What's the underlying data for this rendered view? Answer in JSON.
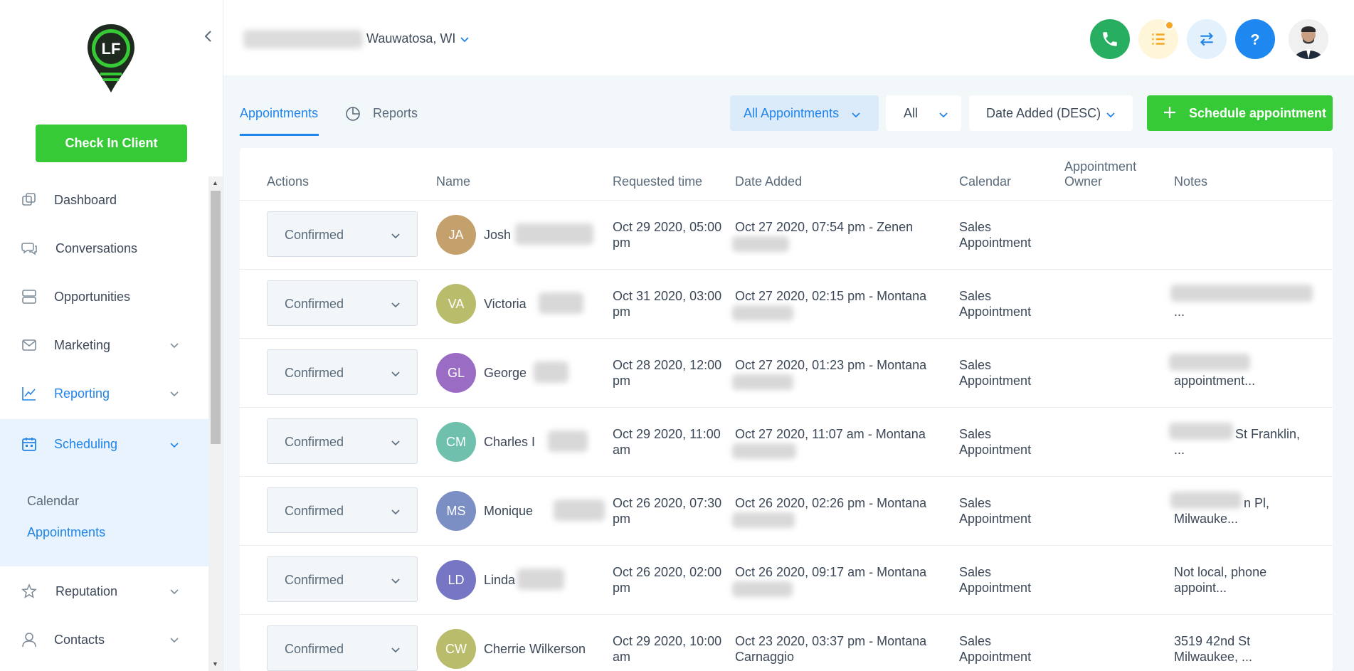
{
  "sidebar": {
    "logo_text": "LF",
    "checkin_label": "Check In Client",
    "items": [
      {
        "label": "Dashboard"
      },
      {
        "label": "Conversations"
      },
      {
        "label": "Opportunities"
      },
      {
        "label": "Marketing"
      },
      {
        "label": "Reporting"
      },
      {
        "label": "Scheduling"
      },
      {
        "label": "Reputation"
      },
      {
        "label": "Contacts"
      }
    ],
    "subitems": [
      {
        "label": "Calendar"
      },
      {
        "label": "Appointments"
      }
    ]
  },
  "header": {
    "location": "Wauwatosa, WI"
  },
  "tabs": [
    {
      "label": "Appointments"
    },
    {
      "label": "Reports"
    }
  ],
  "filters": {
    "type": "All Appointments",
    "status": "All",
    "sort": "Date Added (DESC)",
    "schedule_button": "Schedule appointment"
  },
  "table": {
    "headers": {
      "actions": "Actions",
      "name": "Name",
      "requested": "Requested time",
      "added": "Date Added",
      "calendar": "Calendar",
      "owner_1": "Appointment",
      "owner_2": "Owner",
      "notes": "Notes"
    },
    "rows": [
      {
        "status": "Confirmed",
        "initials": "JA",
        "color": "#c4a06d",
        "name": "Josh",
        "req1": "Oct 29 2020, 05:00",
        "req2": "pm",
        "add1": "Oct 27 2020, 07:54 pm - Zenen",
        "add2": "",
        "cal1": "Sales",
        "cal2": "Appointment",
        "notes1": "",
        "notes2": ""
      },
      {
        "status": "Confirmed",
        "initials": "VA",
        "color": "#b9bd6b",
        "name": "Victoria",
        "req1": "Oct 31 2020, 03:00",
        "req2": "pm",
        "add1": "Oct 27 2020, 02:15 pm - Montana",
        "add2": "",
        "cal1": "Sales",
        "cal2": "Appointment",
        "notes1": "",
        "notes2": "..."
      },
      {
        "status": "Confirmed",
        "initials": "GL",
        "color": "#9b6cc4",
        "name": "George",
        "req1": "Oct 28 2020, 12:00",
        "req2": "pm",
        "add1": "Oct 27 2020, 01:23 pm - Montana",
        "add2": "",
        "cal1": "Sales",
        "cal2": "Appointment",
        "notes1": "",
        "notes2": "appointment..."
      },
      {
        "status": "Confirmed",
        "initials": "CM",
        "color": "#6fc1ad",
        "name": "Charles I",
        "req1": "Oct 29 2020, 11:00",
        "req2": "am",
        "add1": "Oct 27 2020, 11:07 am - Montana",
        "add2": "",
        "cal1": "Sales",
        "cal2": "Appointment",
        "notes1": "St Franklin,",
        "notes2": "..."
      },
      {
        "status": "Confirmed",
        "initials": "MS",
        "color": "#7b8fc4",
        "name": "Monique",
        "req1": "Oct 26 2020, 07:30",
        "req2": "pm",
        "add1": "Oct 26 2020, 02:26 pm - Montana",
        "add2": "",
        "cal1": "Sales",
        "cal2": "Appointment",
        "notes1": "n Pl,",
        "notes2": "Milwauke..."
      },
      {
        "status": "Confirmed",
        "initials": "LD",
        "color": "#7676c4",
        "name": "Linda",
        "req1": "Oct 26 2020, 02:00",
        "req2": "pm",
        "add1": "Oct 26 2020, 09:17 am - Montana",
        "add2": "",
        "cal1": "Sales",
        "cal2": "Appointment",
        "notes1": "Not local, phone",
        "notes2": "appoint..."
      },
      {
        "status": "Confirmed",
        "initials": "CW",
        "color": "#b9bd6b",
        "name": "Cherrie Wilkerson",
        "req1": "Oct 29 2020, 10:00",
        "req2": "am",
        "add1": "Oct 23 2020, 03:37 pm - Montana",
        "add2": "Carnaggio",
        "cal1": "Sales",
        "cal2": "Appointment",
        "notes1": "3519 42nd St",
        "notes2": "Milwaukee, ..."
      }
    ]
  },
  "colors": {
    "accent": "#2184e8",
    "green": "#37ca37"
  }
}
